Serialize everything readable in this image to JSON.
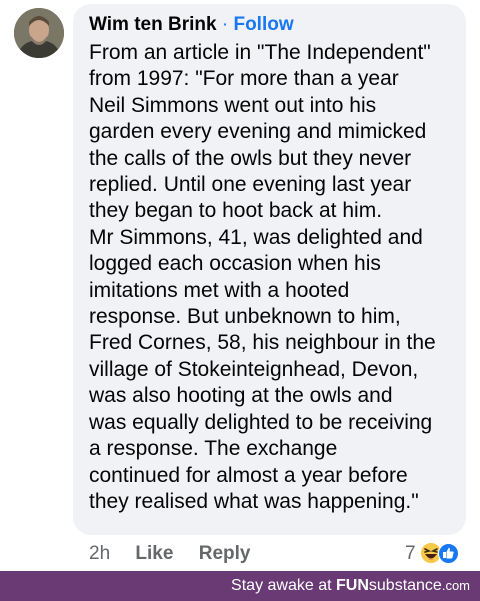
{
  "comment": {
    "author": "Wim ten Brink",
    "separator": "·",
    "follow_label": "Follow",
    "text": "From an article in \"The Independent\"\nfrom 1997: \"For more than a year\nNeil Simmons went out into his\ngarden every evening and mimicked\nthe calls of the owls but they never\nreplied. Until one evening last year\nthey began to hoot back at him.\nMr Simmons, 41, was delighted and\nlogged each occasion when his\nimitations met with a hooted\nresponse. But unbeknown to him,\nFred Cornes, 58, his neighbour in the\nvillage of Stokeinteignhead, Devon,\nwas also hooting at the owls and\nwas equally delighted to be receiving\na response. The exchange\ncontinued for almost a year before\nthey realised what was happening.\"",
    "avatar_icon": "profile-photo",
    "bubble_color": "#f0f2f5",
    "accent_color": "#1877f2"
  },
  "actions": {
    "time": "2h",
    "like_label": "Like",
    "reply_label": "Reply"
  },
  "reactions": {
    "count": "7",
    "icons": [
      "haha-emoji-icon",
      "like-thumb-icon"
    ]
  },
  "footer": {
    "prefix": "Stay awake at ",
    "brand_fun": "FUN",
    "brand_substance": "substance",
    "brand_com": ".com",
    "background": "#6a3a75"
  }
}
